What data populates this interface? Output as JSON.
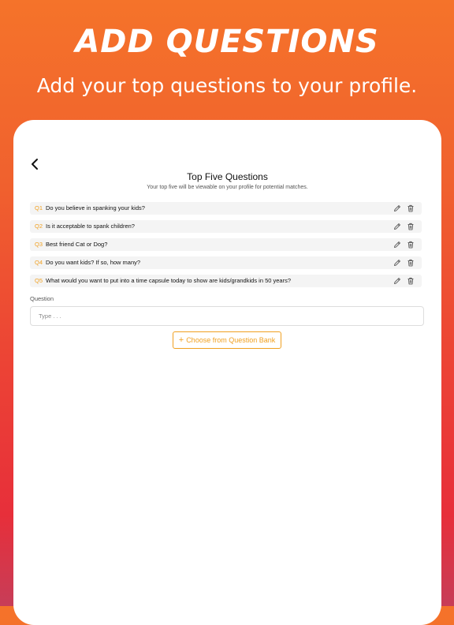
{
  "promo": {
    "title": "ADD QUESTIONS",
    "subtitle": "Add your top questions to your profile."
  },
  "header": {
    "back_icon": "chevron-left-icon",
    "title": "Top Five Questions",
    "description": "Your top five will be viewable on your profile for potential matches."
  },
  "questions": [
    {
      "number": "Q1",
      "text": "Do you believe in spanking your kids?"
    },
    {
      "number": "Q2",
      "text": "Is it acceptable to spank children?"
    },
    {
      "number": "Q3",
      "text": "Best friend Cat or Dog?"
    },
    {
      "number": "Q4",
      "text": "Do you want kids? If so, how many?"
    },
    {
      "number": "Q5",
      "text": "What would you want to put into a time capsule today to show are kids/grandkids  in 50 years?"
    }
  ],
  "question_actions": {
    "edit_icon": "pencil-icon",
    "delete_icon": "trash-icon"
  },
  "form": {
    "label": "Question",
    "placeholder": "Type . . .",
    "bank_button_icon": "+",
    "bank_button_label": "Choose from Question Bank"
  },
  "colors": {
    "accent": "#f0a020",
    "background_top": "#f5732a",
    "background_bottom": "#c73d58"
  }
}
